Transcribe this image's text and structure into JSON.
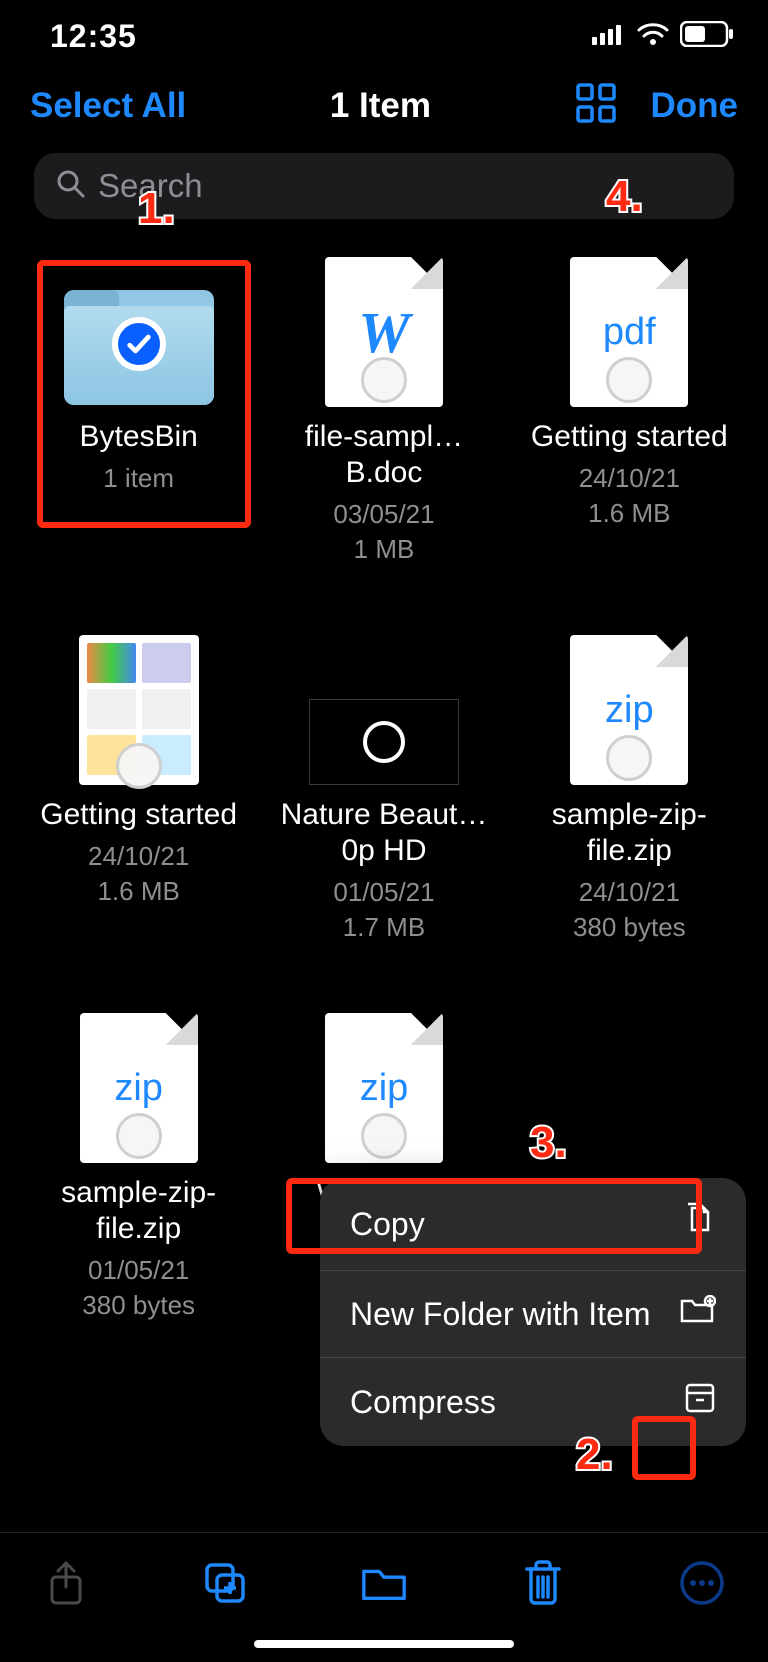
{
  "status": {
    "time": "12:35"
  },
  "nav": {
    "select_all": "Select All",
    "title": "1 Item",
    "done": "Done"
  },
  "search": {
    "placeholder": "Search"
  },
  "items": [
    {
      "name": "BytesBin",
      "sub1": "1 item",
      "sub2": ""
    },
    {
      "name": "file-sampl…B.doc",
      "sub1": "03/05/21",
      "sub2": "1 MB",
      "label": "W"
    },
    {
      "name": "Getting started",
      "sub1": "24/10/21",
      "sub2": "1.6 MB",
      "label": "pdf"
    },
    {
      "name": "Getting started",
      "sub1": "24/10/21",
      "sub2": "1.6 MB"
    },
    {
      "name": "Nature Beaut…0p HD",
      "sub1": "01/05/21",
      "sub2": "1.7 MB"
    },
    {
      "name": "sample-zip-file.zip",
      "sub1": "24/10/21",
      "sub2": "380 bytes",
      "label": "zip"
    },
    {
      "name": "sample-zip-file.zip",
      "sub1": "01/05/21",
      "sub2": "380 bytes",
      "label": "zip"
    },
    {
      "name": "WhatsA…",
      "sub1": "",
      "sub2": "",
      "label": "zip"
    }
  ],
  "menu": {
    "copy": "Copy",
    "new_folder": "New Folder with Item",
    "compress": "Compress"
  },
  "annotations": {
    "n1": "1.",
    "n2": "2.",
    "n3": "3.",
    "n4": "4."
  }
}
